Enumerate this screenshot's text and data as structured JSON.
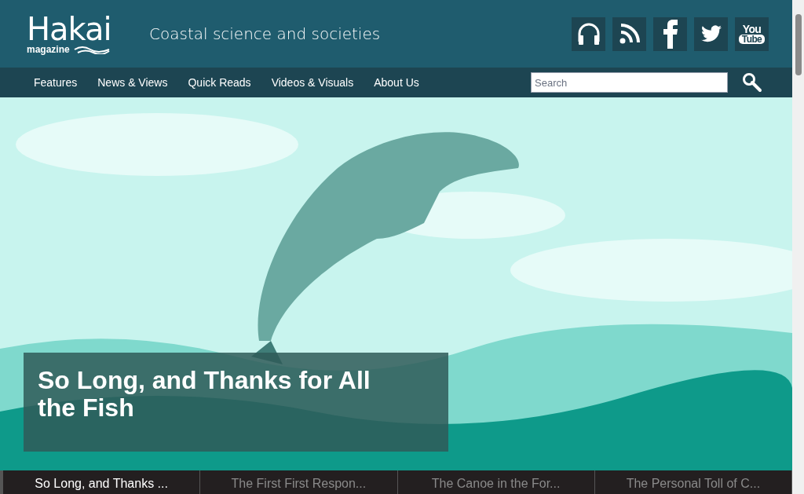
{
  "logo": {
    "name": "Hakai",
    "sub": "magazine"
  },
  "tagline": "Coastal science and societies",
  "social": [
    {
      "kind": "podcast"
    },
    {
      "kind": "rss"
    },
    {
      "kind": "facebook"
    },
    {
      "kind": "twitter"
    },
    {
      "kind": "youtube",
      "top": "You",
      "bottom": "Tube"
    }
  ],
  "nav": [
    "Features",
    "News & Views",
    "Quick Reads",
    "Videos & Visuals",
    "About Us"
  ],
  "search": {
    "placeholder": "Search"
  },
  "hero": {
    "title": "So Long, and Thanks for All the Fish"
  },
  "slides": [
    {
      "label": "So Long, and Thanks ...",
      "selected": true
    },
    {
      "label": "The First First Respon...",
      "selected": false
    },
    {
      "label": "The Canoe in the For...",
      "selected": false
    },
    {
      "label": "The Personal Toll of C...",
      "selected": false
    }
  ]
}
